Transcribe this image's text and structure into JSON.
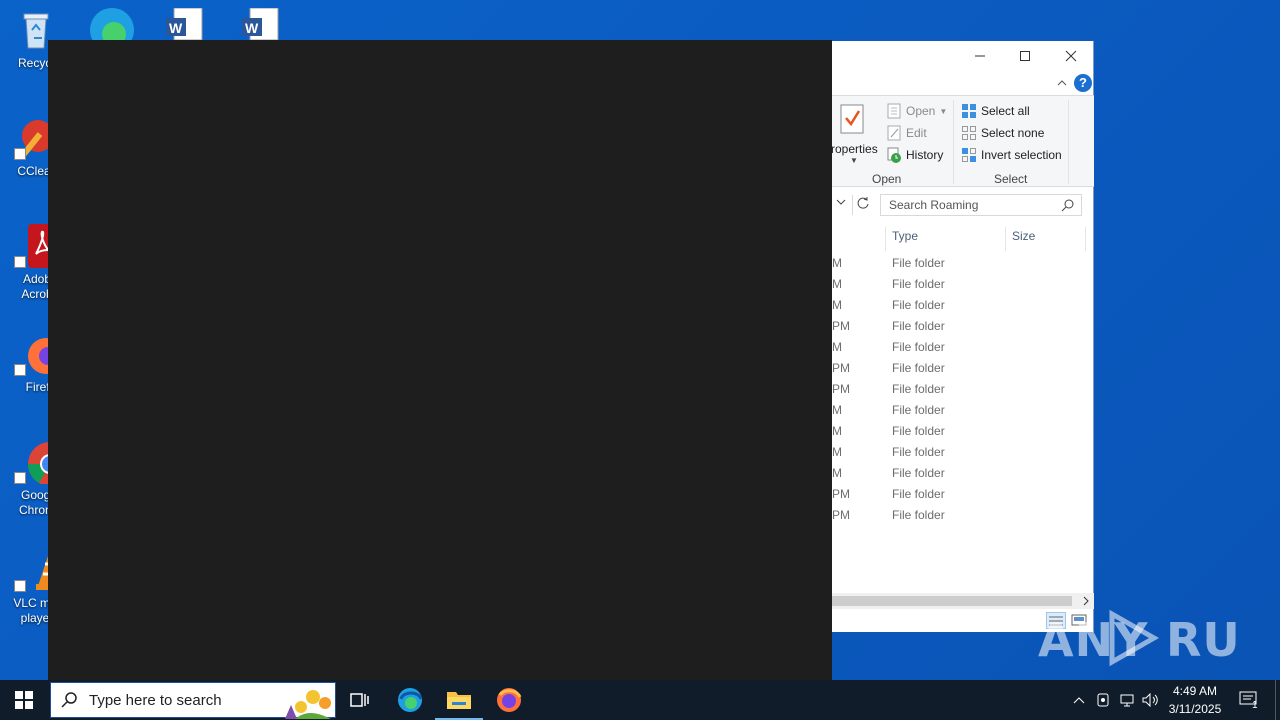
{
  "desktop": {
    "icons": [
      {
        "label": "Recycl",
        "name": "recycle-bin"
      },
      {
        "label": "CClear",
        "name": "ccleaner"
      },
      {
        "label": "Adob Acrob",
        "name": "adobe-acrobat"
      },
      {
        "label": "Firefo",
        "name": "firefox"
      },
      {
        "label": "Googl Chrom",
        "name": "google-chrome"
      },
      {
        "label": "VLC me playe",
        "name": "vlc"
      }
    ]
  },
  "explorer": {
    "ribbon": {
      "properties_label": "roperties",
      "open_label": "Open",
      "edit_label": "Edit",
      "history_label": "History",
      "select_all_label": "Select all",
      "select_none_label": "Select none",
      "invert_selection_label": "Invert selection",
      "group_open": "Open",
      "group_select": "Select"
    },
    "search_placeholder": "Search Roaming",
    "columns": {
      "type": "Type",
      "size": "Size"
    },
    "rows": [
      {
        "date": "M",
        "type": "File folder"
      },
      {
        "date": "M",
        "type": "File folder"
      },
      {
        "date": "M",
        "type": "File folder"
      },
      {
        "date": "PM",
        "type": "File folder"
      },
      {
        "date": "M",
        "type": "File folder"
      },
      {
        "date": "PM",
        "type": "File folder"
      },
      {
        "date": "PM",
        "type": "File folder"
      },
      {
        "date": "M",
        "type": "File folder"
      },
      {
        "date": "M",
        "type": "File folder"
      },
      {
        "date": "M",
        "type": "File folder"
      },
      {
        "date": "M",
        "type": "File folder"
      },
      {
        "date": "PM",
        "type": "File folder"
      },
      {
        "date": "PM",
        "type": "File folder"
      }
    ]
  },
  "watermark": "ANY RUN",
  "taskbar": {
    "search_text": "Type here to search",
    "time": "4:49 AM",
    "date": "3/11/2025",
    "notification_count": "1"
  },
  "colors": {
    "desktop_bg": "#0a5cc2",
    "taskbar_bg": "#101c2a",
    "overlay_bg": "#1e1e1e",
    "accent": "#0078d7"
  }
}
